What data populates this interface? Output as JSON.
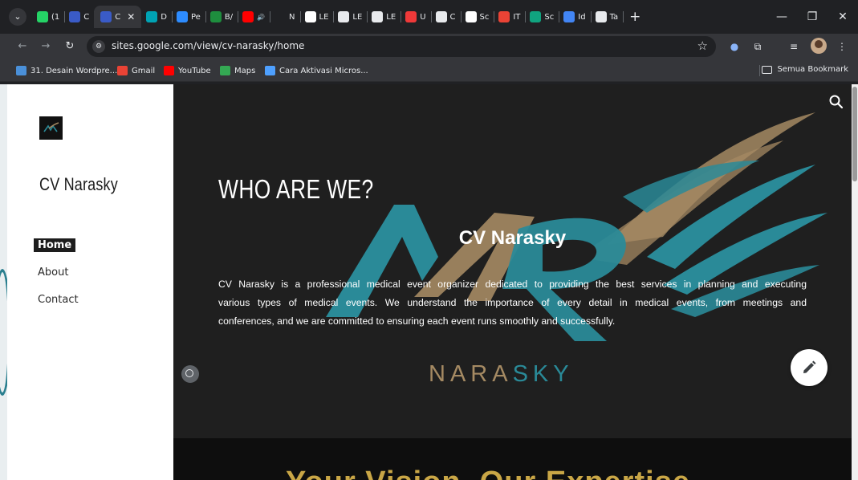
{
  "browser": {
    "tabs": [
      {
        "label": "(1",
        "favicon": "whatsapp-icon",
        "color": "#25d366"
      },
      {
        "label": "C",
        "favicon": "sites-icon",
        "color": "#3a5bc7"
      },
      {
        "label": "C",
        "favicon": "sites-icon",
        "color": "#3a5bc7",
        "active": true
      },
      {
        "label": "D",
        "favicon": "canva-icon",
        "color": "#00a3b4"
      },
      {
        "label": "Pe",
        "favicon": "zoom-icon",
        "color": "#2d8cff"
      },
      {
        "label": "B/",
        "favicon": "sheets-icon",
        "color": "#1e8e3e"
      },
      {
        "label": "",
        "favicon": "youtube-icon",
        "color": "#ff0000",
        "audio": true
      },
      {
        "label": "N",
        "favicon": "notion-icon",
        "color": "#202124"
      },
      {
        "label": "LE",
        "favicon": "google-icon",
        "color": "#ffffff"
      },
      {
        "label": "LE",
        "favicon": "doc-icon",
        "color": "#e8eaed"
      },
      {
        "label": "LE",
        "favicon": "doc-icon",
        "color": "#e8eaed"
      },
      {
        "label": "U",
        "favicon": "vivaldi-icon",
        "color": "#ef3939"
      },
      {
        "label": "C",
        "favicon": "chatgpt-icon",
        "color": "#e8eaed"
      },
      {
        "label": "Sc",
        "favicon": "google-icon",
        "color": "#ffffff"
      },
      {
        "label": "IT",
        "favicon": "maps-icon",
        "color": "#ea4335"
      },
      {
        "label": "Sc",
        "favicon": "chatgpt-icon",
        "color": "#10a37f"
      },
      {
        "label": "Id",
        "favicon": "docs-icon",
        "color": "#4285f4"
      },
      {
        "label": "Ta",
        "favicon": "chrome-icon",
        "color": "#e8eaed"
      }
    ],
    "url": "sites.google.com/view/cv-narasky/home",
    "bookmarks": [
      {
        "label": "31. Desain Wordpre...",
        "icon": "bookmark-site-icon",
        "color": "#4a90d9"
      },
      {
        "label": "Gmail",
        "icon": "gmail-icon",
        "color": "#ea4335"
      },
      {
        "label": "YouTube",
        "icon": "youtube-icon",
        "color": "#ff0000"
      },
      {
        "label": "Maps",
        "icon": "maps-icon",
        "color": "#34a853"
      },
      {
        "label": "Cara Aktivasi Micros...",
        "icon": "bookmark-site-icon",
        "color": "#4ea0ff"
      }
    ],
    "all_bookmarks": "Semua Bookmark"
  },
  "site": {
    "title": "CV Narasky",
    "nav": [
      {
        "label": "Home",
        "active": true
      },
      {
        "label": "About"
      },
      {
        "label": "Contact"
      }
    ]
  },
  "hero": {
    "heading": "WHO ARE WE?",
    "subheading": "CV Narasky",
    "description_lines": [
      "CV Narasky is a professional medical event organizer dedicated to providing the best services in planning and executing",
      "various types of medical events. We understand the importance of every detail in medical events, from meetings and",
      "conferences, and we are committed to ensuring each event runs smoothly and successfully."
    ],
    "wordmark_a": "NARA",
    "wordmark_b": "SKY"
  },
  "lower": {
    "tagline": "Your Vision, Our Expertise"
  },
  "colors": {
    "teal": "#2a8a98",
    "gold": "#a58a63",
    "hero_bg": "#1f1f1f",
    "tagline": "#c9a646"
  }
}
